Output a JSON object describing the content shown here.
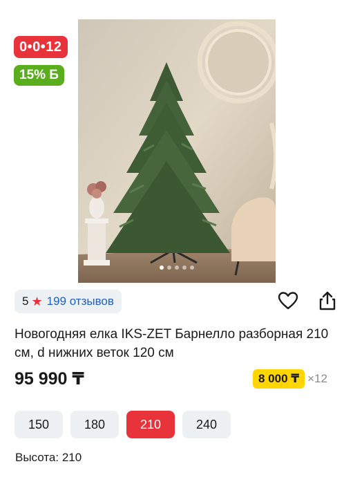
{
  "badges": {
    "timer": "0•0•12",
    "discount": "15% Б"
  },
  "gallery": {
    "current_index": 1,
    "total": 5
  },
  "rating": {
    "score": "5",
    "reviews": "199 отзывов"
  },
  "product": {
    "title": "Новогодняя елка IKS-ZET Барнелло разборная 210 см, d нижних веток 120 см",
    "price": "95 990 ₸"
  },
  "installment": {
    "amount": "8 000 ₸",
    "months": "×12"
  },
  "sizes": [
    {
      "label": "150",
      "selected": false
    },
    {
      "label": "180",
      "selected": false
    },
    {
      "label": "210",
      "selected": true
    },
    {
      "label": "240",
      "selected": false
    }
  ],
  "spec": {
    "height": "Высота: 210"
  },
  "colors": {
    "accent_red": "#e8333a",
    "discount_green": "#5aad1c",
    "installment_yellow": "#ffd600",
    "link_blue": "#1f5fbf"
  },
  "icons": {
    "favorite": "heart-outline-icon",
    "share": "share-icon",
    "star": "star-icon"
  }
}
